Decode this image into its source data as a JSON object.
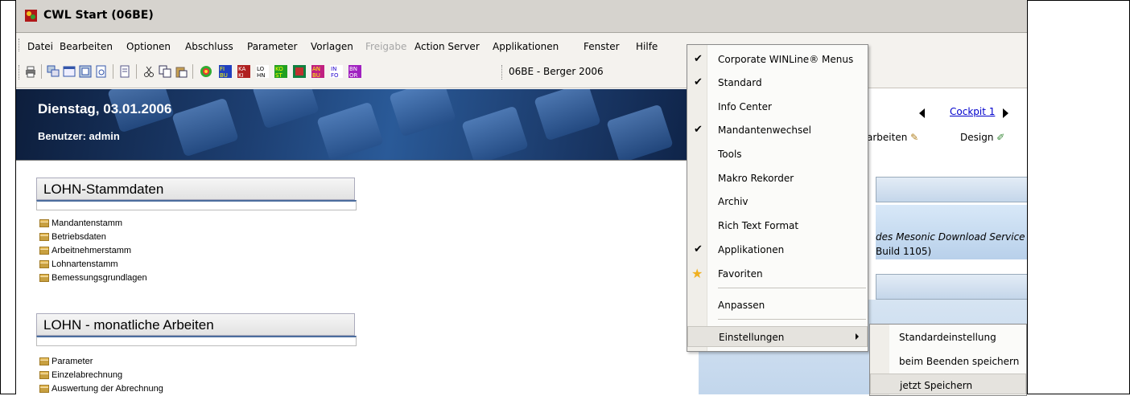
{
  "window": {
    "title": "CWL Start (06BE)"
  },
  "menubar": {
    "items": [
      "Datei",
      "Bearbeiten",
      "Optionen",
      "Abschluss",
      "Parameter",
      "Vorlagen",
      "Freigabe",
      "Action Server",
      "Applikationen",
      "Fenster",
      "Hilfe"
    ],
    "disabled": [
      "Freigabe"
    ]
  },
  "toolbar": {
    "mandant_label": "06BE - Berger 2006",
    "module_icons": [
      "FI BU",
      "KA KI",
      "LO HN",
      "KO ST",
      "BI",
      "AN BU",
      "IN FO",
      "BN OR"
    ]
  },
  "banner": {
    "date": "Dienstag, 03.01.2006",
    "user": "Benutzer: admin"
  },
  "cockpit": {
    "link": "Cockpit 1",
    "arbeiten": "arbeiten",
    "design": "Design"
  },
  "sections": [
    {
      "title": "LOHN-Stammdaten",
      "items": [
        "Mandantenstamm",
        "Betriebsdaten",
        "Arbeitnehmerstamm",
        "Lohnartenstamm",
        "Bemessungsgrundlagen"
      ]
    },
    {
      "title": "LOHN - monatliche Arbeiten",
      "items": [
        "Parameter",
        "Einzelabrechnung",
        "Auswertung der Abrechnung"
      ]
    }
  ],
  "right_info": {
    "line1": "des Mesonic Download Service",
    "line2": "Build 1105)"
  },
  "context_menu": {
    "items": [
      {
        "label": "Corporate WINLine® Menus",
        "checked": true
      },
      {
        "label": "Standard",
        "checked": true
      },
      {
        "label": "Info Center",
        "checked": false
      },
      {
        "label": "Mandantenwechsel",
        "checked": true
      },
      {
        "label": "Tools",
        "checked": false
      },
      {
        "label": "Makro Rekorder",
        "checked": false
      },
      {
        "label": "Archiv",
        "checked": false
      },
      {
        "label": "Rich Text Format",
        "checked": false
      },
      {
        "label": "Applikationen",
        "checked": true
      },
      {
        "label": "Favoriten",
        "checked": false,
        "icon": "star-icon"
      },
      {
        "label": "Anpassen",
        "checked": false
      },
      {
        "label": "Einstellungen",
        "checked": false,
        "submenu": true,
        "highlighted": true
      }
    ],
    "check_glyph": "✔"
  },
  "submenu": {
    "items": [
      "Standardeinstellung",
      "beim Beenden speichern",
      "jetzt Speichern"
    ],
    "highlighted_index": 2
  }
}
